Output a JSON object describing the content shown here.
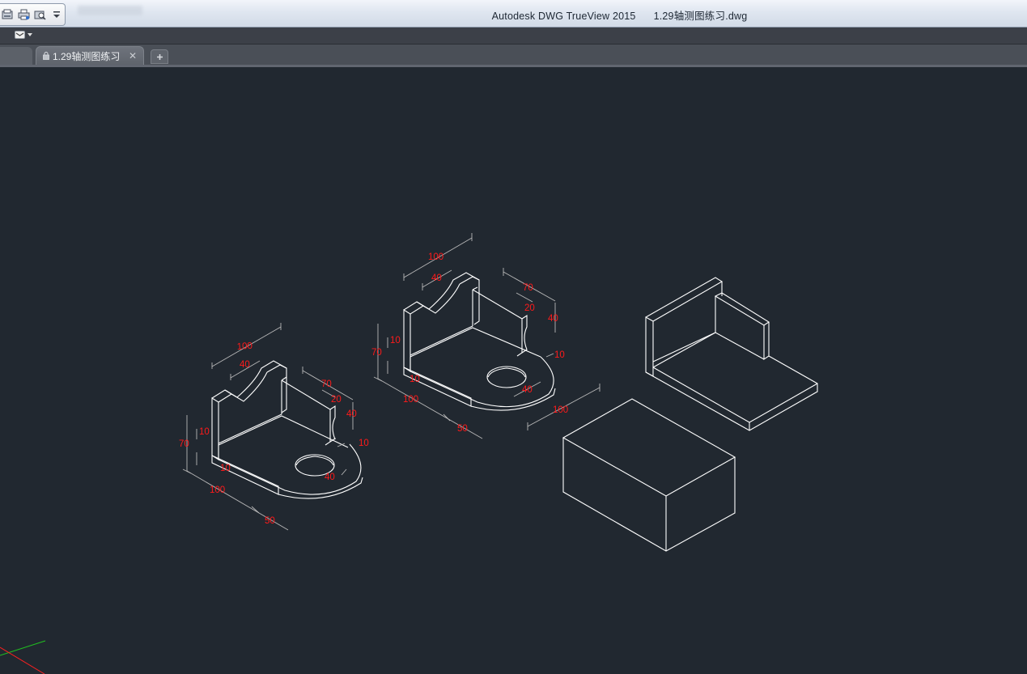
{
  "window": {
    "app_name": "Autodesk DWG TrueView 2015",
    "file_name": "1.29轴测图练习.dwg"
  },
  "tabs": {
    "active_label": "1.29轴测图练习"
  },
  "colors": {
    "canvas_background": "#212830",
    "geometry": "#ffffff",
    "dimension_text": "#ff1a1a",
    "dimension_lines": "#b8b8b8",
    "ucs_x_axis": "#ff2020",
    "ucs_y_axis": "#20c020"
  },
  "icons": {
    "quick_access": [
      "open-icon",
      "print-icon",
      "plot-preview-icon",
      "dropdown-icon"
    ],
    "app_menu": "app-menu-icon",
    "new_tab": "plus-icon",
    "tab_lock": "lock-icon",
    "tab_close": "close-icon"
  },
  "drawing": {
    "left_part_dims": {
      "top_width": "100",
      "arc_width": "40",
      "right_depth": "70",
      "right_inner": "20",
      "right_height": "40",
      "plate_thickness_left": "10",
      "overall_height": "70",
      "base_inner": "10",
      "base_length": "100",
      "base_end": "50",
      "lug_thickness": "10",
      "hole": "40"
    },
    "middle_part_dims": {
      "top_width": "100",
      "arc_width": "40",
      "right_depth": "70",
      "right_inner": "20",
      "right_height": "40",
      "plate_thickness_left": "10",
      "overall_height": "70",
      "base_inner": "10",
      "base_length": "100",
      "base_end": "50",
      "lug_thickness": "10",
      "hole": "40",
      "extra_length": "100"
    }
  }
}
